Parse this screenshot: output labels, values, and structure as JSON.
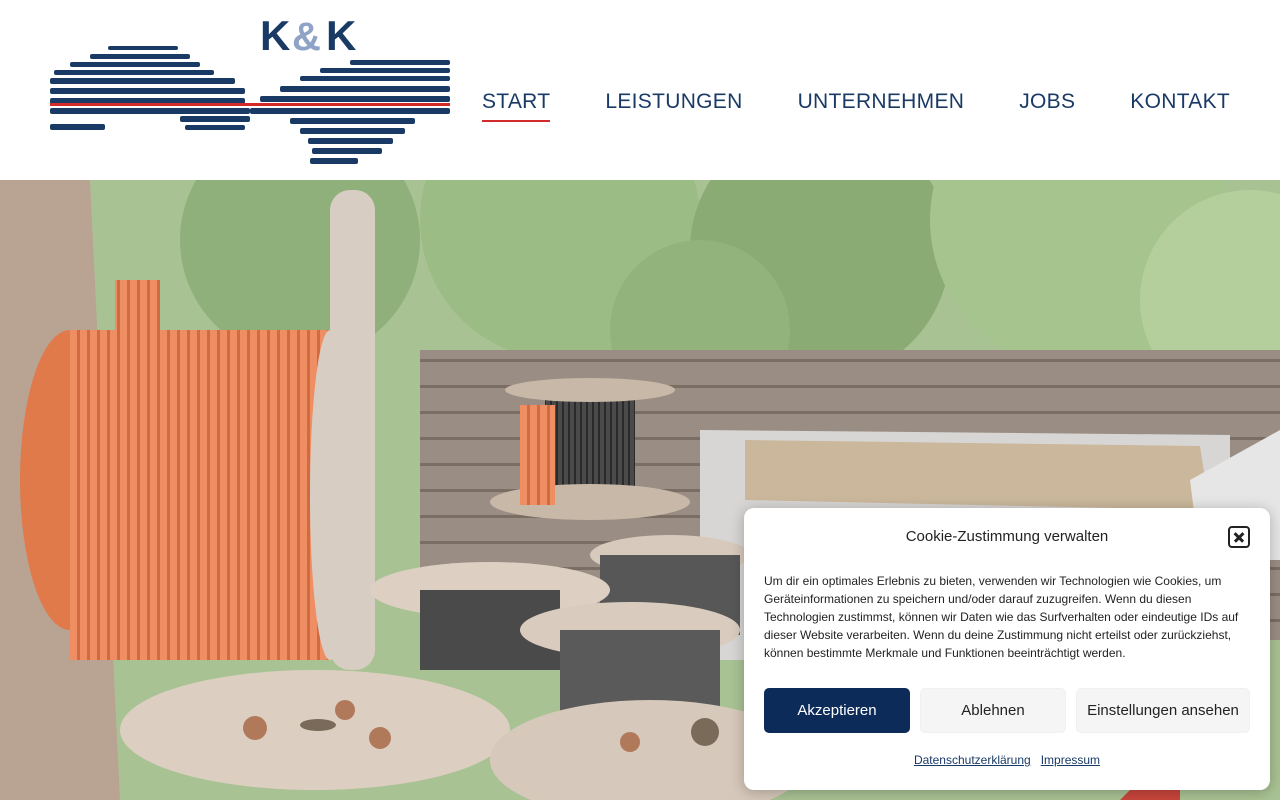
{
  "header": {
    "logo_text": "K&K",
    "nav": [
      {
        "label": "START",
        "active": true
      },
      {
        "label": "LEISTUNGEN",
        "active": false
      },
      {
        "label": "UNTERNEHMEN",
        "active": false
      },
      {
        "label": "JOBS",
        "active": false
      },
      {
        "label": "KONTAKT",
        "active": false
      }
    ]
  },
  "colors": {
    "brand_navy": "#0d2b58",
    "nav_text": "#1a3a66",
    "accent_red": "#d42a2a",
    "logo_ampersand": "#8fa3c6"
  },
  "cookie": {
    "title": "Cookie-Zustimmung verwalten",
    "text": "Um dir ein optimales Erlebnis zu bieten, verwenden wir Technologien wie Cookies, um Geräteinformationen zu speichern und/oder darauf zuzugreifen. Wenn du diesen Technologien zustimmst, können wir Daten wie das Surfverhalten oder eindeutige IDs auf dieser Website verarbeiten. Wenn du deine Zustimmung nicht erteilst oder zurückziehst, können bestimmte Merkmale und Funktionen beeinträchtigt werden.",
    "accept_label": "Akzeptieren",
    "deny_label": "Ablehnen",
    "settings_label": "Einstellungen ansehen",
    "privacy_link": "Datenschutzerklärung",
    "imprint_link": "Impressum"
  }
}
